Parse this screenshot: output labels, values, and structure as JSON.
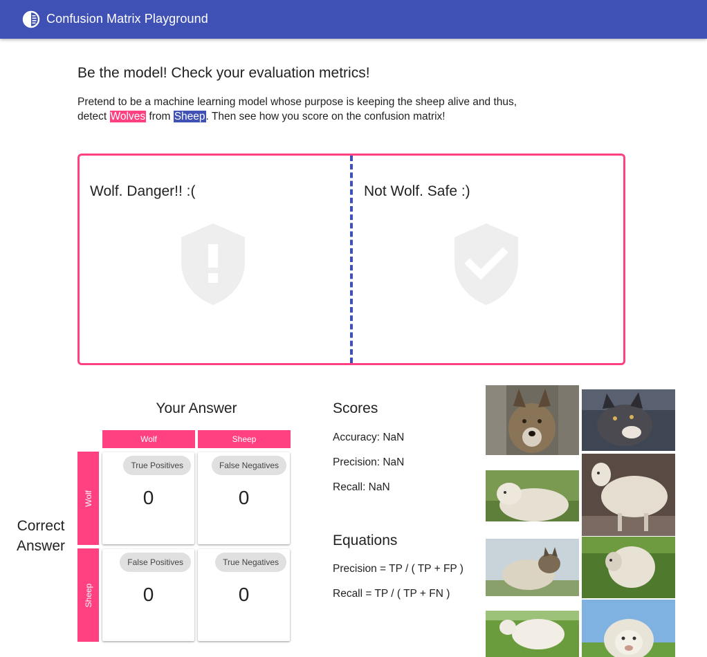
{
  "app": {
    "title": "Confusion Matrix Playground",
    "logo_icon": "contrast-circle-icon",
    "primary_color": "#3f51b5",
    "accent_color": "#ff4081"
  },
  "intro": {
    "heading": "Be the model! Check your evaluation metrics!",
    "text_before": "Pretend to be a machine learning model whose purpose is keeping the sheep alive and thus, detect ",
    "wolves_label": "Wolves",
    "text_middle": " from ",
    "sheep_label": "Sheep",
    "text_after": ". Then see how you score on the confusion matrix!"
  },
  "dropzones": {
    "wolf": {
      "label": "Wolf. Danger!! :(",
      "icon": "shield-alert-icon"
    },
    "safe": {
      "label": "Not Wolf. Safe :)",
      "icon": "shield-check-icon"
    }
  },
  "matrix": {
    "your_answer": "Your Answer",
    "correct_answer_line1": "Correct",
    "correct_answer_line2": "Answer",
    "columns": [
      "Wolf",
      "Sheep"
    ],
    "rows": [
      "Wolf",
      "Sheep"
    ],
    "cells": [
      {
        "label": "True Positives",
        "value": "0"
      },
      {
        "label": "False Negatives",
        "value": "0"
      },
      {
        "label": "False Positives",
        "value": "0"
      },
      {
        "label": "True Negatives",
        "value": "0"
      }
    ]
  },
  "scores": {
    "title": "Scores",
    "accuracy": "Accuracy: NaN",
    "precision": "Precision: NaN",
    "recall": "Recall: NaN"
  },
  "equations": {
    "title": "Equations",
    "precision": "Precision = TP / ( TP + FP )",
    "recall": "Recall = TP / ( TP + FN )"
  },
  "photos": [
    {
      "subject": "wolf"
    },
    {
      "subject": "wolf"
    },
    {
      "subject": "sheep"
    },
    {
      "subject": "sheep"
    },
    {
      "subject": "wolf"
    },
    {
      "subject": "sheep"
    },
    {
      "subject": "sheep"
    },
    {
      "subject": "sheep"
    }
  ]
}
